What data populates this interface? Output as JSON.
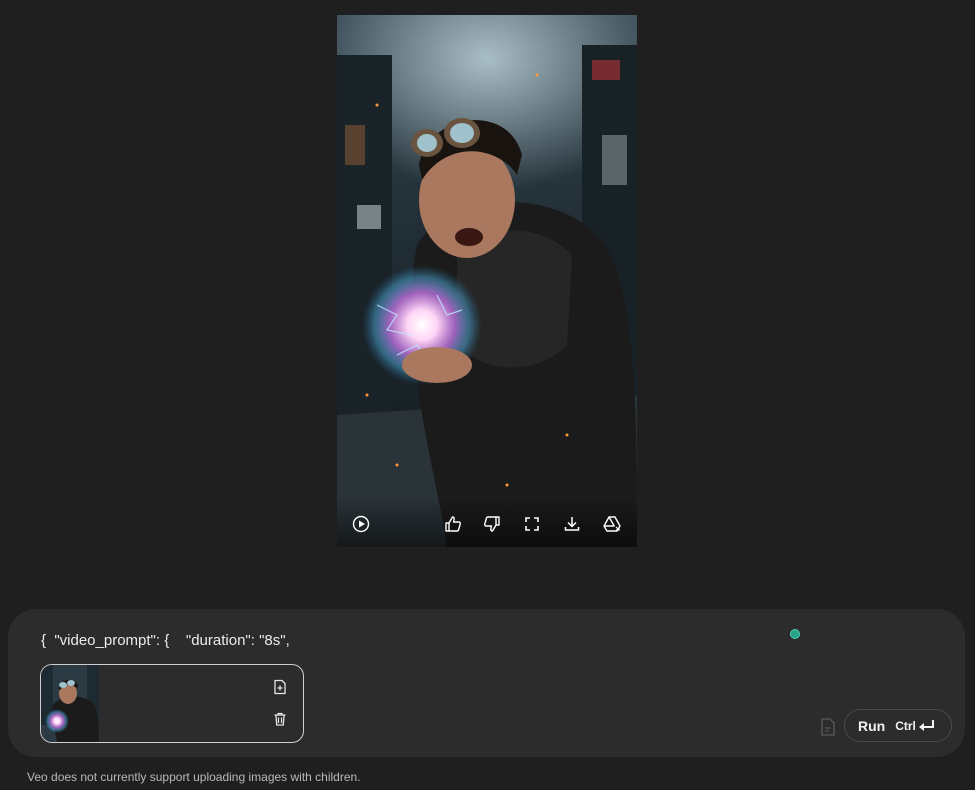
{
  "video": {
    "controls": {
      "play": "play-icon",
      "like": "thumbs-up-icon",
      "dislike": "thumbs-down-icon",
      "fullscreen": "fullscreen-icon",
      "download": "download-icon",
      "drive": "google-drive-icon"
    }
  },
  "prompt": {
    "text": "{  \"video_prompt\": {    \"duration\": \"8s\","
  },
  "attachment": {
    "add_icon": "add-file-icon",
    "delete_icon": "trash-icon"
  },
  "run_button": {
    "label": "Run",
    "shortcut": "Ctrl"
  },
  "disclaimer": "Veo does not currently support uploading images with children.",
  "colors": {
    "background": "#1f1f1f",
    "panel": "#2c2c2c",
    "status_dot": "#2aa38a"
  }
}
